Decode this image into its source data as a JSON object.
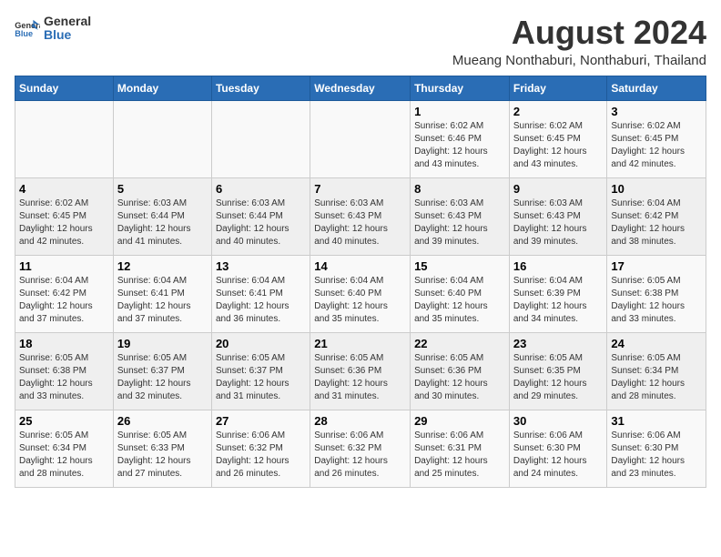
{
  "header": {
    "logo_general": "General",
    "logo_blue": "Blue",
    "month_year": "August 2024",
    "location": "Mueang Nonthaburi, Nonthaburi, Thailand"
  },
  "weekdays": [
    "Sunday",
    "Monday",
    "Tuesday",
    "Wednesday",
    "Thursday",
    "Friday",
    "Saturday"
  ],
  "weeks": [
    [
      {
        "day": "",
        "info": ""
      },
      {
        "day": "",
        "info": ""
      },
      {
        "day": "",
        "info": ""
      },
      {
        "day": "",
        "info": ""
      },
      {
        "day": "1",
        "info": "Sunrise: 6:02 AM\nSunset: 6:46 PM\nDaylight: 12 hours\nand 43 minutes."
      },
      {
        "day": "2",
        "info": "Sunrise: 6:02 AM\nSunset: 6:45 PM\nDaylight: 12 hours\nand 43 minutes."
      },
      {
        "day": "3",
        "info": "Sunrise: 6:02 AM\nSunset: 6:45 PM\nDaylight: 12 hours\nand 42 minutes."
      }
    ],
    [
      {
        "day": "4",
        "info": "Sunrise: 6:02 AM\nSunset: 6:45 PM\nDaylight: 12 hours\nand 42 minutes."
      },
      {
        "day": "5",
        "info": "Sunrise: 6:03 AM\nSunset: 6:44 PM\nDaylight: 12 hours\nand 41 minutes."
      },
      {
        "day": "6",
        "info": "Sunrise: 6:03 AM\nSunset: 6:44 PM\nDaylight: 12 hours\nand 40 minutes."
      },
      {
        "day": "7",
        "info": "Sunrise: 6:03 AM\nSunset: 6:43 PM\nDaylight: 12 hours\nand 40 minutes."
      },
      {
        "day": "8",
        "info": "Sunrise: 6:03 AM\nSunset: 6:43 PM\nDaylight: 12 hours\nand 39 minutes."
      },
      {
        "day": "9",
        "info": "Sunrise: 6:03 AM\nSunset: 6:43 PM\nDaylight: 12 hours\nand 39 minutes."
      },
      {
        "day": "10",
        "info": "Sunrise: 6:04 AM\nSunset: 6:42 PM\nDaylight: 12 hours\nand 38 minutes."
      }
    ],
    [
      {
        "day": "11",
        "info": "Sunrise: 6:04 AM\nSunset: 6:42 PM\nDaylight: 12 hours\nand 37 minutes."
      },
      {
        "day": "12",
        "info": "Sunrise: 6:04 AM\nSunset: 6:41 PM\nDaylight: 12 hours\nand 37 minutes."
      },
      {
        "day": "13",
        "info": "Sunrise: 6:04 AM\nSunset: 6:41 PM\nDaylight: 12 hours\nand 36 minutes."
      },
      {
        "day": "14",
        "info": "Sunrise: 6:04 AM\nSunset: 6:40 PM\nDaylight: 12 hours\nand 35 minutes."
      },
      {
        "day": "15",
        "info": "Sunrise: 6:04 AM\nSunset: 6:40 PM\nDaylight: 12 hours\nand 35 minutes."
      },
      {
        "day": "16",
        "info": "Sunrise: 6:04 AM\nSunset: 6:39 PM\nDaylight: 12 hours\nand 34 minutes."
      },
      {
        "day": "17",
        "info": "Sunrise: 6:05 AM\nSunset: 6:38 PM\nDaylight: 12 hours\nand 33 minutes."
      }
    ],
    [
      {
        "day": "18",
        "info": "Sunrise: 6:05 AM\nSunset: 6:38 PM\nDaylight: 12 hours\nand 33 minutes."
      },
      {
        "day": "19",
        "info": "Sunrise: 6:05 AM\nSunset: 6:37 PM\nDaylight: 12 hours\nand 32 minutes."
      },
      {
        "day": "20",
        "info": "Sunrise: 6:05 AM\nSunset: 6:37 PM\nDaylight: 12 hours\nand 31 minutes."
      },
      {
        "day": "21",
        "info": "Sunrise: 6:05 AM\nSunset: 6:36 PM\nDaylight: 12 hours\nand 31 minutes."
      },
      {
        "day": "22",
        "info": "Sunrise: 6:05 AM\nSunset: 6:36 PM\nDaylight: 12 hours\nand 30 minutes."
      },
      {
        "day": "23",
        "info": "Sunrise: 6:05 AM\nSunset: 6:35 PM\nDaylight: 12 hours\nand 29 minutes."
      },
      {
        "day": "24",
        "info": "Sunrise: 6:05 AM\nSunset: 6:34 PM\nDaylight: 12 hours\nand 28 minutes."
      }
    ],
    [
      {
        "day": "25",
        "info": "Sunrise: 6:05 AM\nSunset: 6:34 PM\nDaylight: 12 hours\nand 28 minutes."
      },
      {
        "day": "26",
        "info": "Sunrise: 6:05 AM\nSunset: 6:33 PM\nDaylight: 12 hours\nand 27 minutes."
      },
      {
        "day": "27",
        "info": "Sunrise: 6:06 AM\nSunset: 6:32 PM\nDaylight: 12 hours\nand 26 minutes."
      },
      {
        "day": "28",
        "info": "Sunrise: 6:06 AM\nSunset: 6:32 PM\nDaylight: 12 hours\nand 26 minutes."
      },
      {
        "day": "29",
        "info": "Sunrise: 6:06 AM\nSunset: 6:31 PM\nDaylight: 12 hours\nand 25 minutes."
      },
      {
        "day": "30",
        "info": "Sunrise: 6:06 AM\nSunset: 6:30 PM\nDaylight: 12 hours\nand 24 minutes."
      },
      {
        "day": "31",
        "info": "Sunrise: 6:06 AM\nSunset: 6:30 PM\nDaylight: 12 hours\nand 23 minutes."
      }
    ]
  ]
}
